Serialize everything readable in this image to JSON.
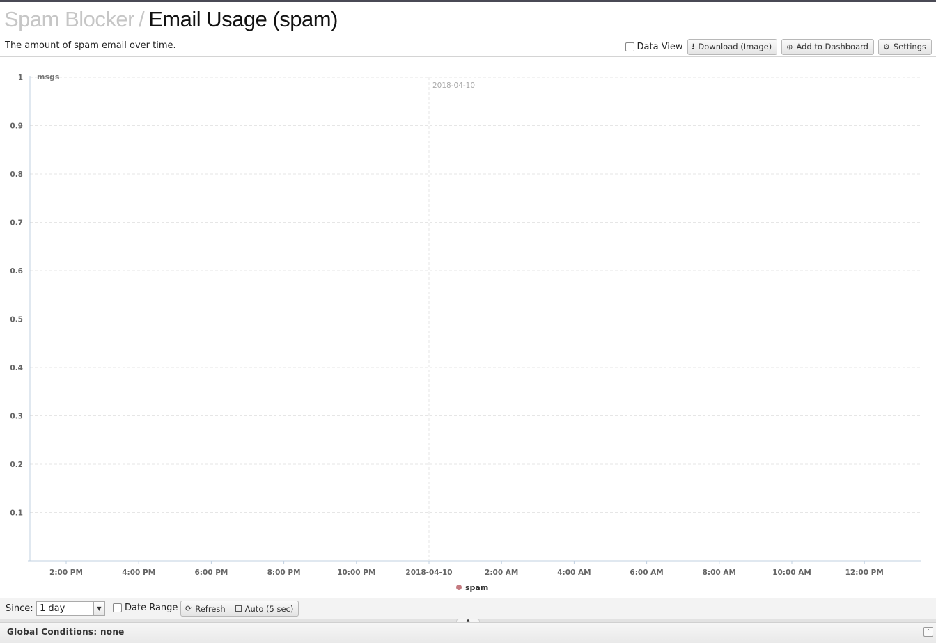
{
  "header": {
    "breadcrumb_parent": "Spam Blocker",
    "separator": "/",
    "title": "Email Usage (spam)",
    "description": "The amount of spam email over time."
  },
  "toolbar": {
    "data_view_label": "Data View",
    "download_label": "Download (Image)",
    "add_dashboard_label": "Add to Dashboard",
    "settings_label": "Settings"
  },
  "chart_data": {
    "type": "line",
    "ylabel": "msgs",
    "ylim": [
      0,
      1
    ],
    "yticks": [
      "0.1",
      "0.2",
      "0.3",
      "0.4",
      "0.5",
      "0.6",
      "0.7",
      "0.8",
      "0.9",
      "1"
    ],
    "xticks": [
      "2:00 PM",
      "4:00 PM",
      "6:00 PM",
      "8:00 PM",
      "10:00 PM",
      "2018-04-10",
      "2:00 AM",
      "4:00 AM",
      "6:00 AM",
      "8:00 AM",
      "10:00 AM",
      "12:00 PM"
    ],
    "date_marker": "2018-04-10",
    "series": [
      {
        "name": "spam",
        "color": "#c47a80",
        "values": []
      }
    ],
    "legend_position": "bottom",
    "grid": true
  },
  "controls": {
    "since_label": "Since:",
    "since_value": "1 day",
    "date_range_label": "Date Range",
    "refresh_label": "Refresh",
    "auto_label": "Auto (5 sec)"
  },
  "footer": {
    "global_conditions": "Global Conditions: none"
  }
}
